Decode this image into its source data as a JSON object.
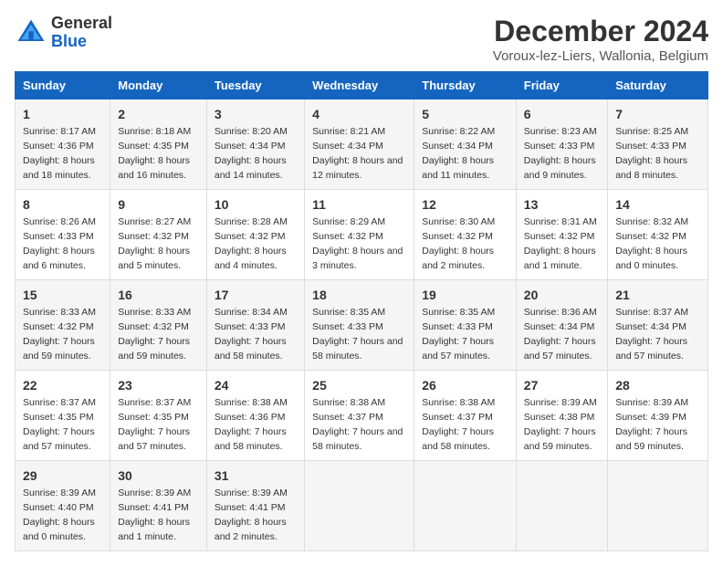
{
  "logo": {
    "line1": "General",
    "line2": "Blue"
  },
  "title": "December 2024",
  "subtitle": "Voroux-lez-Liers, Wallonia, Belgium",
  "days": [
    "Sunday",
    "Monday",
    "Tuesday",
    "Wednesday",
    "Thursday",
    "Friday",
    "Saturday"
  ],
  "weeks": [
    [
      {
        "day": "1",
        "sunrise": "8:17 AM",
        "sunset": "4:36 PM",
        "daylight": "8 hours and 18 minutes."
      },
      {
        "day": "2",
        "sunrise": "8:18 AM",
        "sunset": "4:35 PM",
        "daylight": "8 hours and 16 minutes."
      },
      {
        "day": "3",
        "sunrise": "8:20 AM",
        "sunset": "4:34 PM",
        "daylight": "8 hours and 14 minutes."
      },
      {
        "day": "4",
        "sunrise": "8:21 AM",
        "sunset": "4:34 PM",
        "daylight": "8 hours and 12 minutes."
      },
      {
        "day": "5",
        "sunrise": "8:22 AM",
        "sunset": "4:34 PM",
        "daylight": "8 hours and 11 minutes."
      },
      {
        "day": "6",
        "sunrise": "8:23 AM",
        "sunset": "4:33 PM",
        "daylight": "8 hours and 9 minutes."
      },
      {
        "day": "7",
        "sunrise": "8:25 AM",
        "sunset": "4:33 PM",
        "daylight": "8 hours and 8 minutes."
      }
    ],
    [
      {
        "day": "8",
        "sunrise": "8:26 AM",
        "sunset": "4:33 PM",
        "daylight": "8 hours and 6 minutes."
      },
      {
        "day": "9",
        "sunrise": "8:27 AM",
        "sunset": "4:32 PM",
        "daylight": "8 hours and 5 minutes."
      },
      {
        "day": "10",
        "sunrise": "8:28 AM",
        "sunset": "4:32 PM",
        "daylight": "8 hours and 4 minutes."
      },
      {
        "day": "11",
        "sunrise": "8:29 AM",
        "sunset": "4:32 PM",
        "daylight": "8 hours and 3 minutes."
      },
      {
        "day": "12",
        "sunrise": "8:30 AM",
        "sunset": "4:32 PM",
        "daylight": "8 hours and 2 minutes."
      },
      {
        "day": "13",
        "sunrise": "8:31 AM",
        "sunset": "4:32 PM",
        "daylight": "8 hours and 1 minute."
      },
      {
        "day": "14",
        "sunrise": "8:32 AM",
        "sunset": "4:32 PM",
        "daylight": "8 hours and 0 minutes."
      }
    ],
    [
      {
        "day": "15",
        "sunrise": "8:33 AM",
        "sunset": "4:32 PM",
        "daylight": "7 hours and 59 minutes."
      },
      {
        "day": "16",
        "sunrise": "8:33 AM",
        "sunset": "4:32 PM",
        "daylight": "7 hours and 59 minutes."
      },
      {
        "day": "17",
        "sunrise": "8:34 AM",
        "sunset": "4:33 PM",
        "daylight": "7 hours and 58 minutes."
      },
      {
        "day": "18",
        "sunrise": "8:35 AM",
        "sunset": "4:33 PM",
        "daylight": "7 hours and 58 minutes."
      },
      {
        "day": "19",
        "sunrise": "8:35 AM",
        "sunset": "4:33 PM",
        "daylight": "7 hours and 57 minutes."
      },
      {
        "day": "20",
        "sunrise": "8:36 AM",
        "sunset": "4:34 PM",
        "daylight": "7 hours and 57 minutes."
      },
      {
        "day": "21",
        "sunrise": "8:37 AM",
        "sunset": "4:34 PM",
        "daylight": "7 hours and 57 minutes."
      }
    ],
    [
      {
        "day": "22",
        "sunrise": "8:37 AM",
        "sunset": "4:35 PM",
        "daylight": "7 hours and 57 minutes."
      },
      {
        "day": "23",
        "sunrise": "8:37 AM",
        "sunset": "4:35 PM",
        "daylight": "7 hours and 57 minutes."
      },
      {
        "day": "24",
        "sunrise": "8:38 AM",
        "sunset": "4:36 PM",
        "daylight": "7 hours and 58 minutes."
      },
      {
        "day": "25",
        "sunrise": "8:38 AM",
        "sunset": "4:37 PM",
        "daylight": "7 hours and 58 minutes."
      },
      {
        "day": "26",
        "sunrise": "8:38 AM",
        "sunset": "4:37 PM",
        "daylight": "7 hours and 58 minutes."
      },
      {
        "day": "27",
        "sunrise": "8:39 AM",
        "sunset": "4:38 PM",
        "daylight": "7 hours and 59 minutes."
      },
      {
        "day": "28",
        "sunrise": "8:39 AM",
        "sunset": "4:39 PM",
        "daylight": "7 hours and 59 minutes."
      }
    ],
    [
      {
        "day": "29",
        "sunrise": "8:39 AM",
        "sunset": "4:40 PM",
        "daylight": "8 hours and 0 minutes."
      },
      {
        "day": "30",
        "sunrise": "8:39 AM",
        "sunset": "4:41 PM",
        "daylight": "8 hours and 1 minute."
      },
      {
        "day": "31",
        "sunrise": "8:39 AM",
        "sunset": "4:41 PM",
        "daylight": "8 hours and 2 minutes."
      },
      null,
      null,
      null,
      null
    ]
  ]
}
